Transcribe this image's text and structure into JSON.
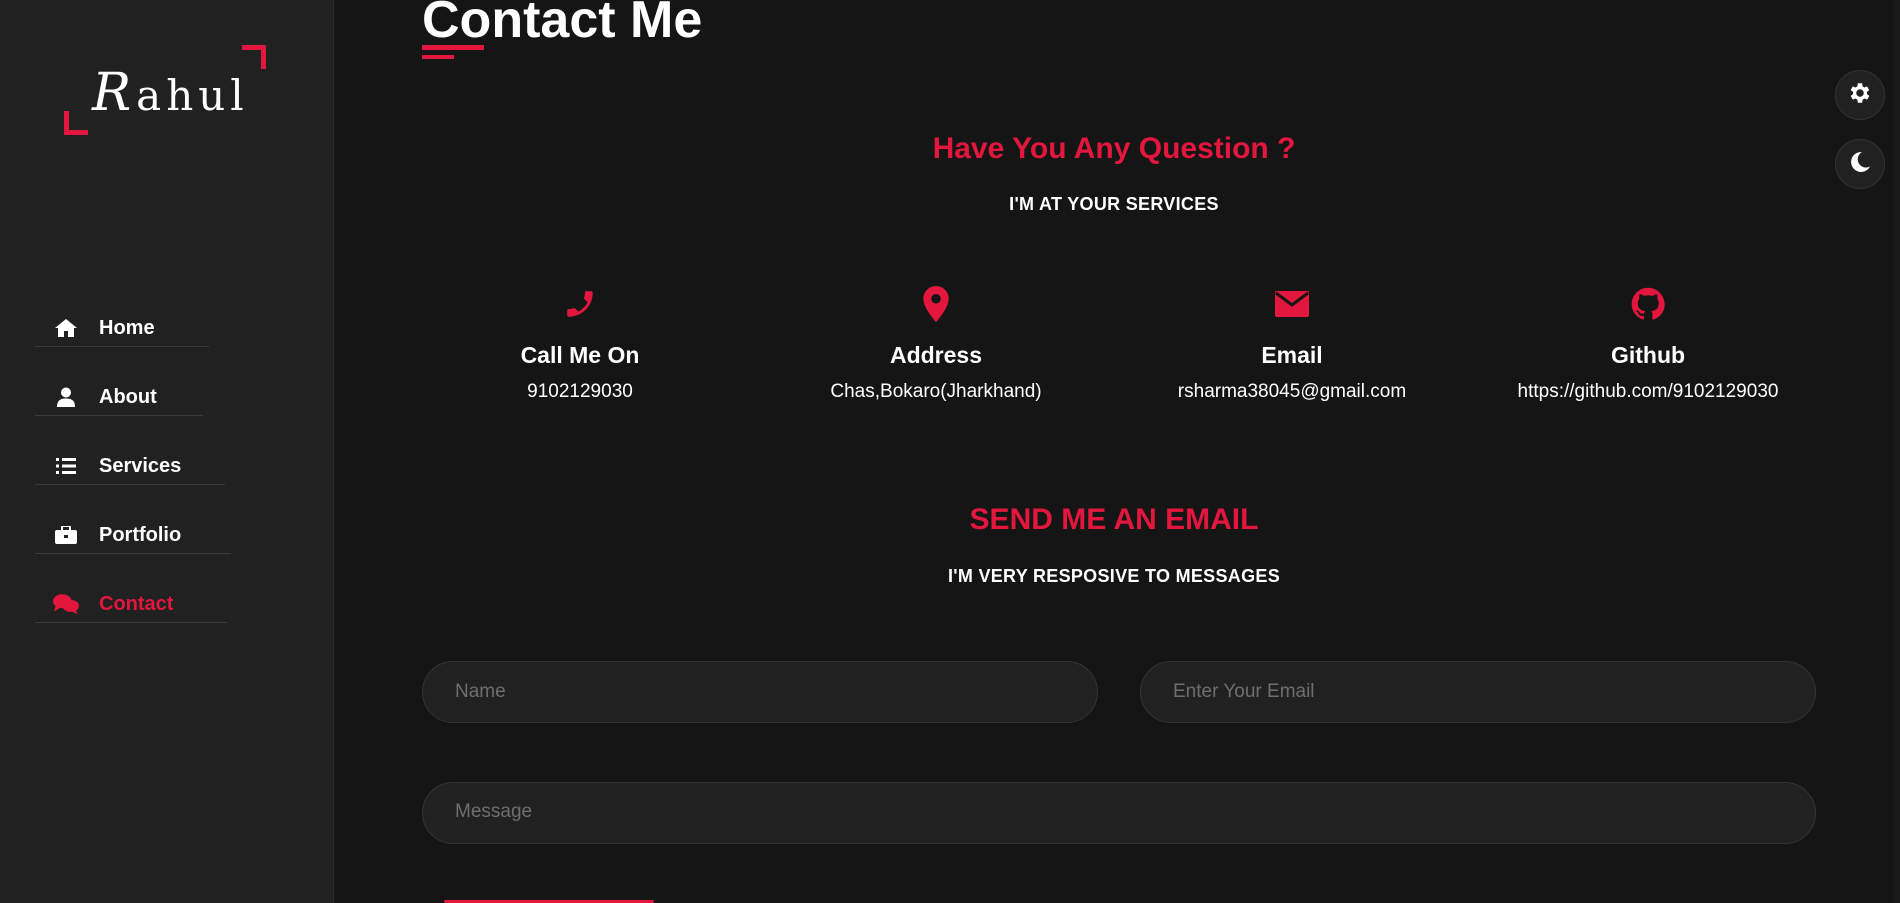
{
  "brand": {
    "logo_text_first": "R",
    "logo_text_rest": "ahul"
  },
  "sidebar": {
    "items": [
      {
        "label": "Home",
        "icon": "home-icon"
      },
      {
        "label": "About",
        "icon": "user-icon"
      },
      {
        "label": "Services",
        "icon": "list-icon"
      },
      {
        "label": "Portfolio",
        "icon": "briefcase-icon"
      },
      {
        "label": "Contact",
        "icon": "comments-icon",
        "active": true
      }
    ]
  },
  "main": {
    "title": "Contact Me",
    "question_heading": "Have You Any Question ?",
    "question_sub": "I'M AT YOUR SERVICES",
    "info": [
      {
        "icon": "phone-icon",
        "title": "Call Me On",
        "value": "9102129030"
      },
      {
        "icon": "location-pin-icon",
        "title": "Address",
        "value": "Chas,Bokaro(Jharkhand)"
      },
      {
        "icon": "envelope-icon",
        "title": "Email",
        "value": "rsharma38045@gmail.com"
      },
      {
        "icon": "github-icon",
        "title": "Github",
        "value": "https://github.com/9102129030"
      }
    ],
    "email_heading": "SEND ME AN EMAIL",
    "email_sub": "I'M VERY RESPOSIVE TO MESSAGES",
    "form": {
      "name_placeholder": "Name",
      "email_placeholder": "Enter Your Email",
      "message_placeholder": "Message"
    }
  },
  "floating": {
    "settings_icon": "gear-icon",
    "theme_icon": "moon-icon"
  },
  "colors": {
    "accent": "#e3173d",
    "background": "#151515",
    "sidebar": "#212121"
  }
}
